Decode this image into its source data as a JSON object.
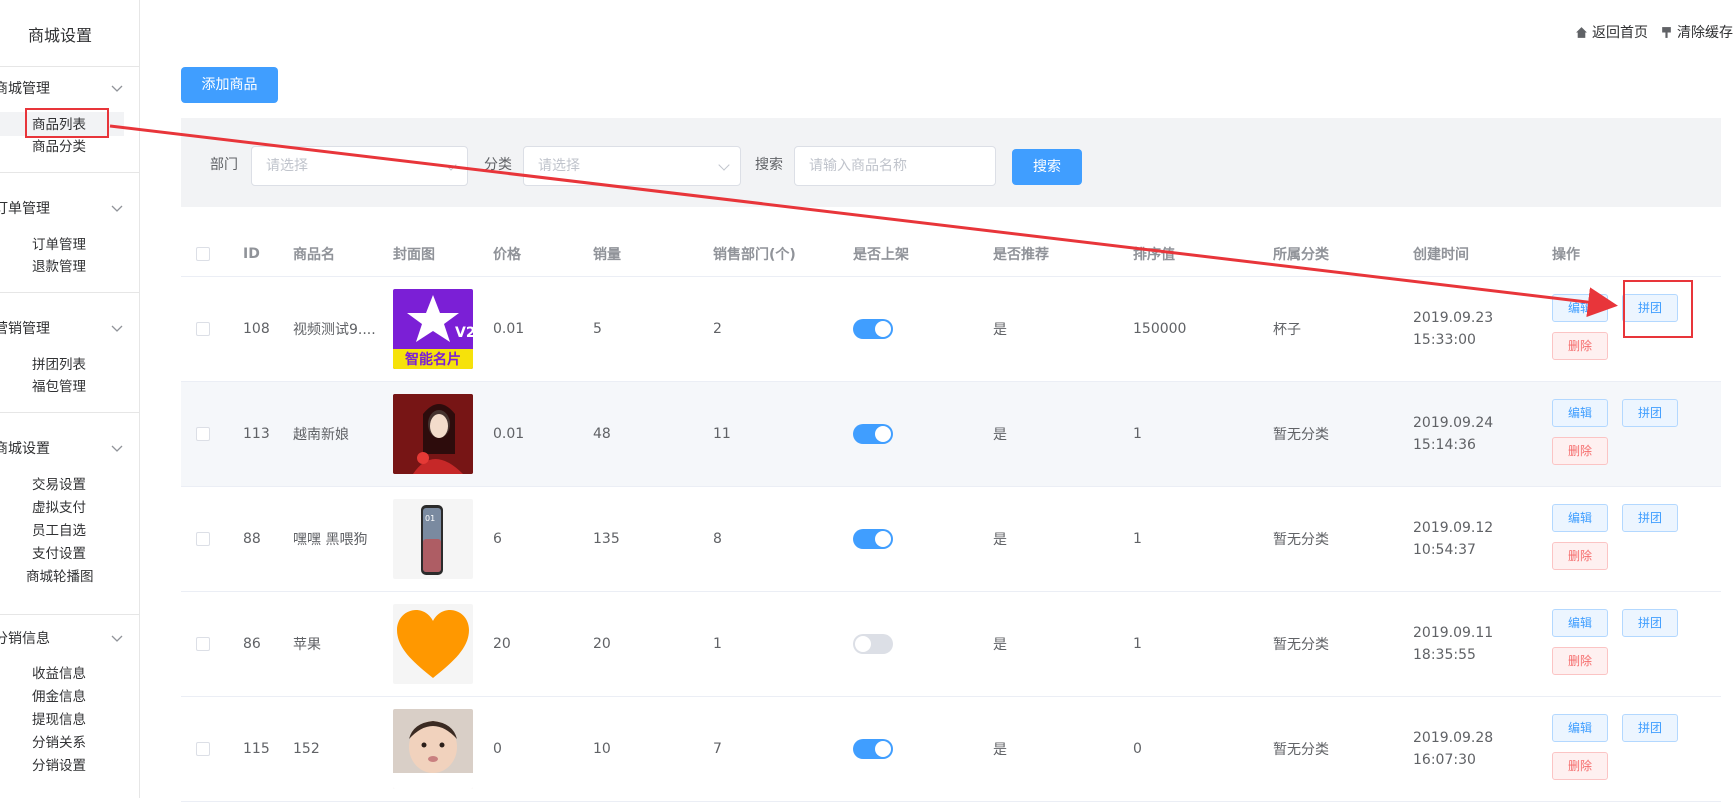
{
  "sidebar": {
    "title": "商城设置",
    "groups": [
      {
        "label": "商城管理",
        "items": [
          "商品列表",
          "商品分类"
        ]
      },
      {
        "label": "订单管理",
        "items": [
          "订单管理",
          "退款管理"
        ]
      },
      {
        "label": "营销管理",
        "items": [
          "拼团列表",
          "福包管理"
        ]
      },
      {
        "label": "商城设置",
        "items": [
          "交易设置",
          "虚拟支付",
          "员工自选",
          "支付设置",
          "商城轮播图"
        ]
      },
      {
        "label": "分销信息",
        "items": [
          "收益信息",
          "佣金信息",
          "提现信息",
          "分销关系",
          "分销设置"
        ]
      }
    ]
  },
  "topbar": {
    "home": "返回首页",
    "clear_cache": "清除缓存"
  },
  "toolbar": {
    "add_product": "添加商品"
  },
  "filter": {
    "dept_label": "部门",
    "dept_placeholder": "请选择",
    "category_label": "分类",
    "category_placeholder": "请选择",
    "search_label": "搜索",
    "search_placeholder": "请输入商品名称",
    "search_button": "搜索"
  },
  "table": {
    "columns": [
      "ID",
      "商品名",
      "封面图",
      "价格",
      "销量",
      "销售部门(个)",
      "是否上架",
      "是否推荐",
      "排序值",
      "所属分类",
      "创建时间",
      "操作"
    ],
    "rows": [
      {
        "id": "108",
        "name": "视频测试9....",
        "cover": "smart-card-logo",
        "price": "0.01",
        "sales": "5",
        "depts": "2",
        "listed": true,
        "recommend": "是",
        "sort": "150000",
        "category": "杯子",
        "date": "2019.09.23",
        "time": "15:33:00"
      },
      {
        "id": "113",
        "name": "越南新娘",
        "cover": "bride-photo",
        "price": "0.01",
        "sales": "48",
        "depts": "11",
        "listed": true,
        "recommend": "是",
        "sort": "1",
        "category": "暂无分类",
        "date": "2019.09.24",
        "time": "15:14:36"
      },
      {
        "id": "88",
        "name": "嘿嘿 黑喂狗",
        "cover": "phone-photo",
        "price": "6",
        "sales": "135",
        "depts": "8",
        "listed": true,
        "recommend": "是",
        "sort": "1",
        "category": "暂无分类",
        "date": "2019.09.12",
        "time": "10:54:37"
      },
      {
        "id": "86",
        "name": "苹果",
        "cover": "orange-heart",
        "price": "20",
        "sales": "20",
        "depts": "1",
        "listed": false,
        "recommend": "是",
        "sort": "1",
        "category": "暂无分类",
        "date": "2019.09.11",
        "time": "18:35:55"
      },
      {
        "id": "115",
        "name": "152",
        "cover": "child-photo",
        "price": "0",
        "sales": "10",
        "depts": "7",
        "listed": true,
        "recommend": "是",
        "sort": "0",
        "category": "暂无分类",
        "date": "2019.09.28",
        "time": "16:07:30"
      }
    ],
    "ops": {
      "edit": "编辑",
      "group": "拼团",
      "delete": "删除"
    }
  },
  "thumb_text": {
    "v2": "V2",
    "smart_card": "智能名片",
    "phone_time": "01"
  },
  "annotation": {
    "color": "#e8353a"
  },
  "colors": {
    "primary": "#409eff",
    "danger": "#f56c6c"
  }
}
